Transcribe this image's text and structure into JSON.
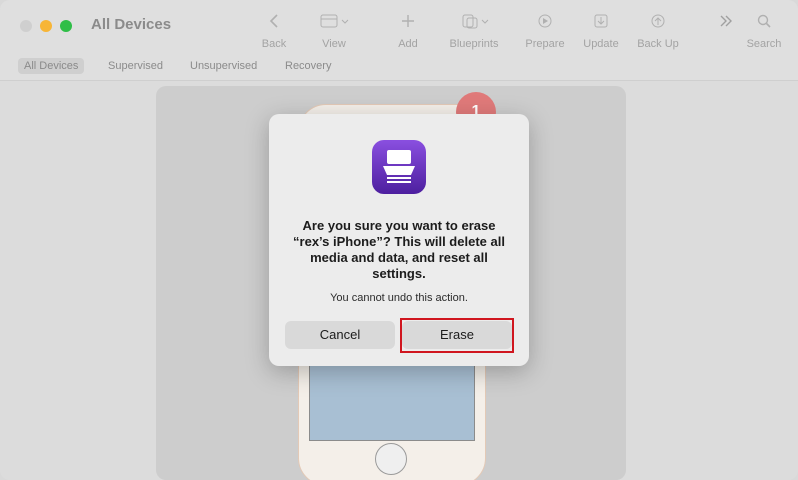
{
  "window": {
    "title": "All Devices"
  },
  "toolbar": [
    {
      "label": "Back",
      "icon": "chevron-left-icon"
    },
    {
      "label": "View",
      "icon": "view-icon"
    },
    {
      "label": "Add",
      "icon": "plus-icon"
    },
    {
      "label": "Blueprints",
      "icon": "blueprints-icon"
    },
    {
      "label": "Prepare",
      "icon": "prepare-icon"
    },
    {
      "label": "Update",
      "icon": "download-icon"
    },
    {
      "label": "Back Up",
      "icon": "upload-icon"
    },
    {
      "label": "Search",
      "icon": "search-icon"
    }
  ],
  "tabs": [
    {
      "label": "All Devices",
      "active": true
    },
    {
      "label": "Supervised"
    },
    {
      "label": "Unsupervised"
    },
    {
      "label": "Recovery"
    }
  ],
  "device": {
    "badge": "1"
  },
  "dialog": {
    "title": "Are you sure you want to erase “rex’s iPhone”? This will delete all media and data, and reset all settings.",
    "message": "You cannot undo this action.",
    "cancel_label": "Cancel",
    "erase_label": "Erase"
  },
  "colors": {
    "accent": "#d0161f",
    "app_icon": "#6a2fc0"
  }
}
